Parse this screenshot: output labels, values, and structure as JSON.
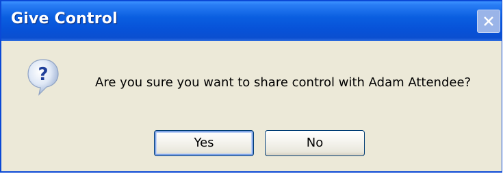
{
  "dialog": {
    "title": "Give Control",
    "message": "Are you sure you want to share control with Adam Attendee?",
    "icon": "question-icon",
    "buttons": {
      "yes_label": "Yes",
      "no_label": "No"
    }
  },
  "colors": {
    "titlebar": "#0752d8",
    "body": "#ece9d8",
    "border": "#0b49d6"
  }
}
